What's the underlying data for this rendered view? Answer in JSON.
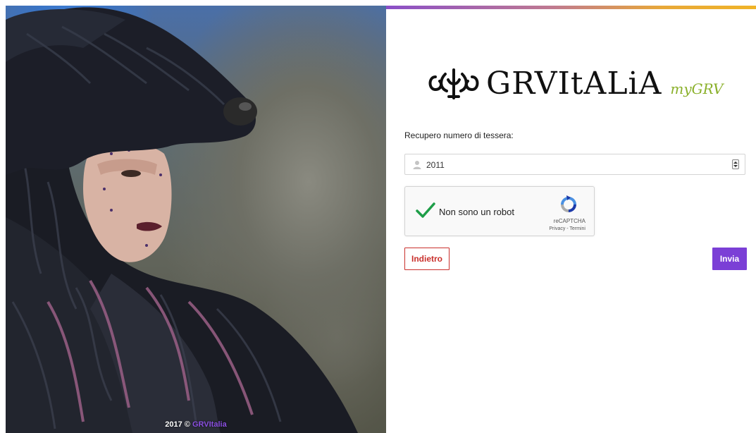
{
  "photo": {
    "description_icon": "photo-woman-fur-costume",
    "caption_year": "2017 ©",
    "caption_brand": "GRVItalia"
  },
  "brand": {
    "logo_text": "GRVItALiA",
    "logo_sub": "myGRV",
    "accent_colors": [
      "#8a4fc8",
      "#f0b428"
    ]
  },
  "form": {
    "label": "Recupero numero di tessera:",
    "number_field": {
      "value": "2011",
      "icon": "user-icon"
    },
    "captcha": {
      "label": "Non sono un robot",
      "brand": "reCAPTCHA",
      "links": "Privacy - Termini",
      "checked": true
    },
    "back_label": "Indietro",
    "send_label": "Invia"
  },
  "colors": {
    "back_button": "#c9302c",
    "send_button": "#7b3fd6",
    "captcha_check": "#1e9e48",
    "logo_sub": "#8ab02a"
  }
}
